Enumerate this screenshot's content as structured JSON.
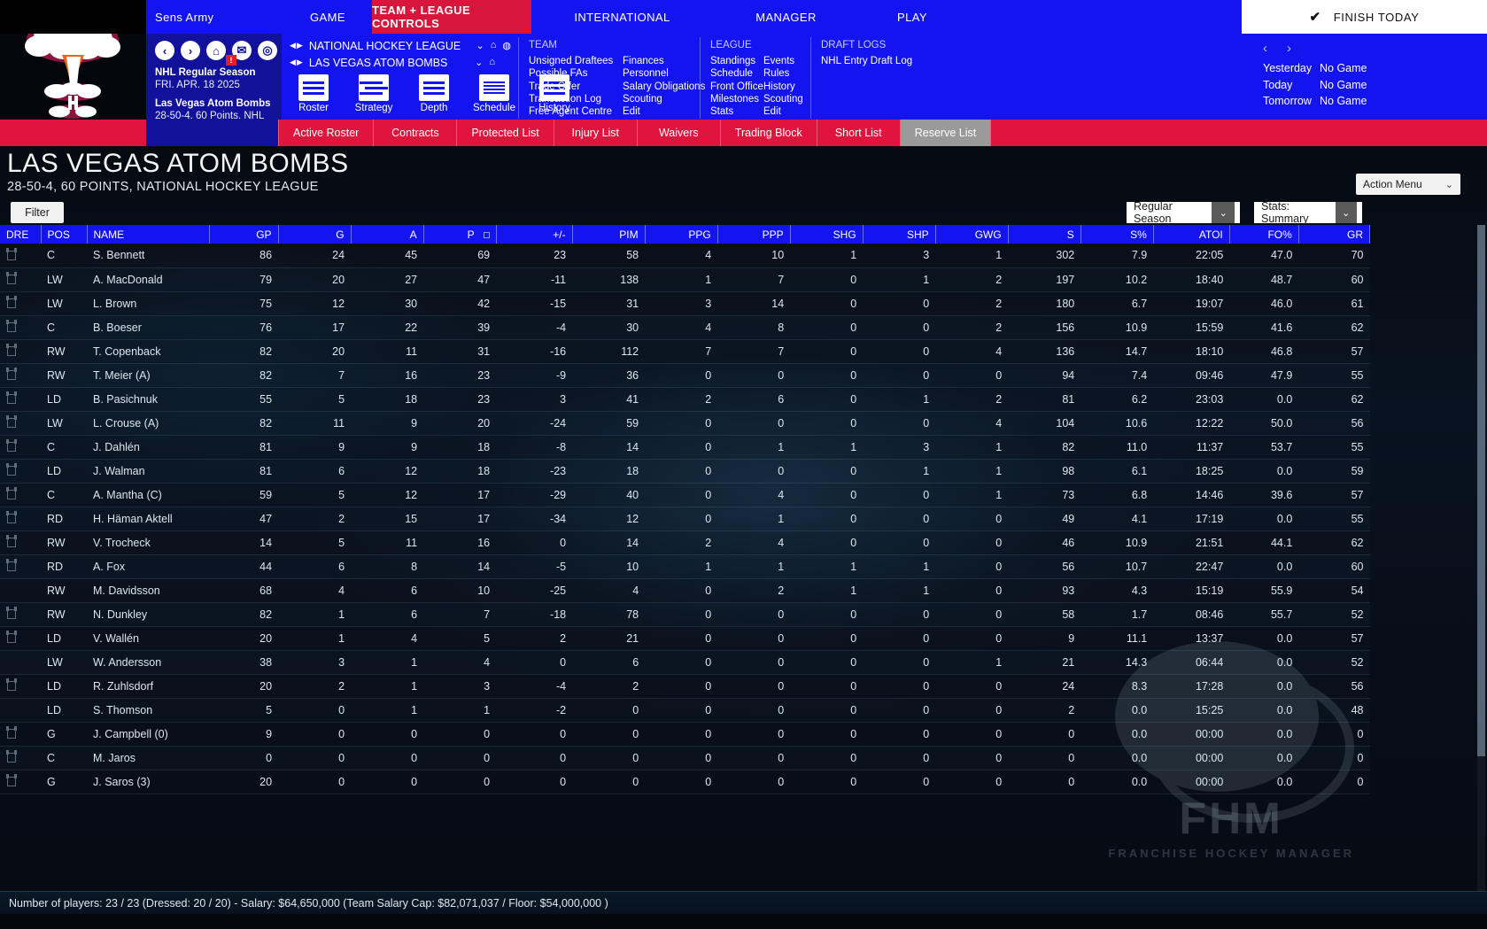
{
  "topmenu": {
    "user": "Sens Army",
    "items": [
      "GAME",
      "TEAM + LEAGUE CONTROLS",
      "INTERNATIONAL",
      "MANAGER",
      "PLAY"
    ],
    "finish_today": "FINISH TODAY",
    "check_icon": "check-icon"
  },
  "navbox": {
    "icons": [
      "back-icon",
      "forward-icon",
      "home-icon",
      "mail-icon",
      "search-icon"
    ],
    "mail_badge": "!",
    "season": "NHL Regular Season",
    "date": "FRI. APR. 18 2025",
    "team": "Las Vegas Atom Bombs",
    "record_line": "28-50-4, 60 Points, NHL"
  },
  "selector": {
    "league": "NATIONAL HOCKEY LEAGUE",
    "team": "LAS VEGAS ATOM BOMBS"
  },
  "quick_icons": [
    {
      "label": "Roster",
      "icon": "roster-icon"
    },
    {
      "label": "Strategy",
      "icon": "strategy-icon"
    },
    {
      "label": "Depth",
      "icon": "depth-icon"
    },
    {
      "label": "Schedule",
      "icon": "schedule-icon"
    },
    {
      "label": "History",
      "icon": "history-icon"
    }
  ],
  "menu_columns": [
    {
      "heading": "TEAM",
      "col_a": [
        "Unsigned Draftees",
        "Possible FAs",
        "Trade Offer",
        "Transaction Log",
        "Free Agent Centre"
      ],
      "col_b": [
        "Finances",
        "Personnel",
        "Salary Obligations",
        "Scouting",
        "Edit"
      ]
    },
    {
      "heading": "LEAGUE",
      "col_a": [
        "Standings",
        "Schedule",
        "Front Office",
        "Milestones",
        "Stats"
      ],
      "col_b": [
        "Events",
        "Rules",
        "History",
        "Scouting",
        "Edit"
      ]
    },
    {
      "heading": "DRAFT LOGS",
      "col_a": [
        "NHL Entry Draft Log"
      ],
      "col_b": []
    }
  ],
  "days": {
    "prev_icon": "chevron-left-icon",
    "next_icon": "chevron-right-icon",
    "rows": [
      {
        "label": "Yesterday",
        "value": "No Game"
      },
      {
        "label": "Today",
        "value": "No Game"
      },
      {
        "label": "Tomorrow",
        "value": "No Game"
      }
    ]
  },
  "tabs": [
    {
      "label": "Active Roster",
      "active": false
    },
    {
      "label": "Contracts",
      "active": false
    },
    {
      "label": "Protected List",
      "active": false
    },
    {
      "label": "Injury List",
      "active": false
    },
    {
      "label": "Waivers",
      "active": false
    },
    {
      "label": "Trading Block",
      "active": false
    },
    {
      "label": "Short List",
      "active": false
    },
    {
      "label": "Reserve List",
      "active": true
    }
  ],
  "page": {
    "title": "LAS VEGAS ATOM BOMBS",
    "subtitle": "28-50-4, 60 POINTS, NATIONAL HOCKEY LEAGUE",
    "action_menu": "Action Menu",
    "filter": "Filter",
    "season_select": "Regular Season",
    "stats_select": "Stats: Summary"
  },
  "colors": {
    "menu_blue": "#1414f0",
    "tab_red": "#e0143c",
    "active_tab_gray": "#9a9a9a",
    "accent_white": "#ffffff",
    "badge_red": "#e21d2e"
  },
  "table": {
    "columns": [
      "DRE",
      "POS",
      "NAME",
      "GP",
      "G",
      "A",
      "P",
      "+/-",
      "PIM",
      "PPG",
      "PPP",
      "SHG",
      "SHP",
      "GWG",
      "S",
      "S%",
      "ATOI",
      "FO%",
      "GR"
    ],
    "sorted_column": "P",
    "rows": [
      {
        "dre": true,
        "pos": "C",
        "name": "S. Bennett",
        "gp": "86",
        "g": "24",
        "a": "45",
        "p": "69",
        "pm": "23",
        "pim": "58",
        "ppg": "4",
        "ppp": "10",
        "shg": "1",
        "shp": "3",
        "gwg": "1",
        "s": "302",
        "sp": "7.9",
        "atoi": "22:05",
        "fo": "47.0",
        "gr": "70"
      },
      {
        "dre": true,
        "pos": "LW",
        "name": "A. MacDonald",
        "gp": "79",
        "g": "20",
        "a": "27",
        "p": "47",
        "pm": "-11",
        "pim": "138",
        "ppg": "1",
        "ppp": "7",
        "shg": "0",
        "shp": "1",
        "gwg": "2",
        "s": "197",
        "sp": "10.2",
        "atoi": "18:40",
        "fo": "48.7",
        "gr": "60"
      },
      {
        "dre": true,
        "pos": "LW",
        "name": "L. Brown",
        "gp": "75",
        "g": "12",
        "a": "30",
        "p": "42",
        "pm": "-15",
        "pim": "31",
        "ppg": "3",
        "ppp": "14",
        "shg": "0",
        "shp": "0",
        "gwg": "2",
        "s": "180",
        "sp": "6.7",
        "atoi": "19:07",
        "fo": "46.0",
        "gr": "61"
      },
      {
        "dre": true,
        "pos": "C",
        "name": "B. Boeser",
        "gp": "76",
        "g": "17",
        "a": "22",
        "p": "39",
        "pm": "-4",
        "pim": "30",
        "ppg": "4",
        "ppp": "8",
        "shg": "0",
        "shp": "0",
        "gwg": "2",
        "s": "156",
        "sp": "10.9",
        "atoi": "15:59",
        "fo": "41.6",
        "gr": "62"
      },
      {
        "dre": true,
        "pos": "RW",
        "name": "T. Copenback",
        "gp": "82",
        "g": "20",
        "a": "11",
        "p": "31",
        "pm": "-16",
        "pim": "112",
        "ppg": "7",
        "ppp": "7",
        "shg": "0",
        "shp": "0",
        "gwg": "4",
        "s": "136",
        "sp": "14.7",
        "atoi": "18:10",
        "fo": "46.8",
        "gr": "57"
      },
      {
        "dre": true,
        "pos": "RW",
        "name": "T. Meier (A)",
        "gp": "82",
        "g": "7",
        "a": "16",
        "p": "23",
        "pm": "-9",
        "pim": "36",
        "ppg": "0",
        "ppp": "0",
        "shg": "0",
        "shp": "0",
        "gwg": "0",
        "s": "94",
        "sp": "7.4",
        "atoi": "09:46",
        "fo": "47.9",
        "gr": "55"
      },
      {
        "dre": true,
        "pos": "LD",
        "name": "B. Pasichnuk",
        "gp": "55",
        "g": "5",
        "a": "18",
        "p": "23",
        "pm": "3",
        "pim": "41",
        "ppg": "2",
        "ppp": "6",
        "shg": "0",
        "shp": "1",
        "gwg": "2",
        "s": "81",
        "sp": "6.2",
        "atoi": "23:03",
        "fo": "0.0",
        "gr": "62"
      },
      {
        "dre": true,
        "pos": "LW",
        "name": "L. Crouse (A)",
        "gp": "82",
        "g": "11",
        "a": "9",
        "p": "20",
        "pm": "-24",
        "pim": "59",
        "ppg": "0",
        "ppp": "0",
        "shg": "0",
        "shp": "0",
        "gwg": "4",
        "s": "104",
        "sp": "10.6",
        "atoi": "12:22",
        "fo": "50.0",
        "gr": "56"
      },
      {
        "dre": true,
        "pos": "C",
        "name": "J. Dahlén",
        "gp": "81",
        "g": "9",
        "a": "9",
        "p": "18",
        "pm": "-8",
        "pim": "14",
        "ppg": "0",
        "ppp": "1",
        "shg": "1",
        "shp": "3",
        "gwg": "1",
        "s": "82",
        "sp": "11.0",
        "atoi": "11:37",
        "fo": "53.7",
        "gr": "55"
      },
      {
        "dre": true,
        "pos": "LD",
        "name": "J. Walman",
        "gp": "81",
        "g": "6",
        "a": "12",
        "p": "18",
        "pm": "-23",
        "pim": "18",
        "ppg": "0",
        "ppp": "0",
        "shg": "0",
        "shp": "1",
        "gwg": "1",
        "s": "98",
        "sp": "6.1",
        "atoi": "18:25",
        "fo": "0.0",
        "gr": "59"
      },
      {
        "dre": true,
        "pos": "C",
        "name": "A. Mantha (C)",
        "gp": "59",
        "g": "5",
        "a": "12",
        "p": "17",
        "pm": "-29",
        "pim": "40",
        "ppg": "0",
        "ppp": "4",
        "shg": "0",
        "shp": "0",
        "gwg": "1",
        "s": "73",
        "sp": "6.8",
        "atoi": "14:46",
        "fo": "39.6",
        "gr": "57"
      },
      {
        "dre": true,
        "pos": "RD",
        "name": "H. Häman Aktell",
        "gp": "47",
        "g": "2",
        "a": "15",
        "p": "17",
        "pm": "-34",
        "pim": "12",
        "ppg": "0",
        "ppp": "1",
        "shg": "0",
        "shp": "0",
        "gwg": "0",
        "s": "49",
        "sp": "4.1",
        "atoi": "17:19",
        "fo": "0.0",
        "gr": "55"
      },
      {
        "dre": true,
        "pos": "RW",
        "name": "V. Trocheck",
        "gp": "14",
        "g": "5",
        "a": "11",
        "p": "16",
        "pm": "0",
        "pim": "14",
        "ppg": "2",
        "ppp": "4",
        "shg": "0",
        "shp": "0",
        "gwg": "0",
        "s": "46",
        "sp": "10.9",
        "atoi": "21:51",
        "fo": "44.1",
        "gr": "62"
      },
      {
        "dre": true,
        "pos": "RD",
        "name": "A. Fox",
        "gp": "44",
        "g": "6",
        "a": "8",
        "p": "14",
        "pm": "-5",
        "pim": "10",
        "ppg": "1",
        "ppp": "1",
        "shg": "1",
        "shp": "1",
        "gwg": "0",
        "s": "56",
        "sp": "10.7",
        "atoi": "22:47",
        "fo": "0.0",
        "gr": "60"
      },
      {
        "dre": false,
        "pos": "RW",
        "name": "M. Davidsson",
        "gp": "68",
        "g": "4",
        "a": "6",
        "p": "10",
        "pm": "-25",
        "pim": "4",
        "ppg": "0",
        "ppp": "2",
        "shg": "1",
        "shp": "1",
        "gwg": "0",
        "s": "93",
        "sp": "4.3",
        "atoi": "15:19",
        "fo": "55.9",
        "gr": "54"
      },
      {
        "dre": true,
        "pos": "RW",
        "name": "N. Dunkley",
        "gp": "82",
        "g": "1",
        "a": "6",
        "p": "7",
        "pm": "-18",
        "pim": "78",
        "ppg": "0",
        "ppp": "0",
        "shg": "0",
        "shp": "0",
        "gwg": "0",
        "s": "58",
        "sp": "1.7",
        "atoi": "08:46",
        "fo": "55.7",
        "gr": "52"
      },
      {
        "dre": true,
        "pos": "LD",
        "name": "V. Wallén",
        "gp": "20",
        "g": "1",
        "a": "4",
        "p": "5",
        "pm": "2",
        "pim": "21",
        "ppg": "0",
        "ppp": "0",
        "shg": "0",
        "shp": "0",
        "gwg": "0",
        "s": "9",
        "sp": "11.1",
        "atoi": "13:37",
        "fo": "0.0",
        "gr": "57"
      },
      {
        "dre": false,
        "pos": "LW",
        "name": "W. Andersson",
        "gp": "38",
        "g": "3",
        "a": "1",
        "p": "4",
        "pm": "0",
        "pim": "6",
        "ppg": "0",
        "ppp": "0",
        "shg": "0",
        "shp": "0",
        "gwg": "1",
        "s": "21",
        "sp": "14.3",
        "atoi": "06:44",
        "fo": "0.0",
        "gr": "52"
      },
      {
        "dre": true,
        "pos": "LD",
        "name": "R. Zuhlsdorf",
        "gp": "20",
        "g": "2",
        "a": "1",
        "p": "3",
        "pm": "-4",
        "pim": "2",
        "ppg": "0",
        "ppp": "0",
        "shg": "0",
        "shp": "0",
        "gwg": "0",
        "s": "24",
        "sp": "8.3",
        "atoi": "17:28",
        "fo": "0.0",
        "gr": "56"
      },
      {
        "dre": false,
        "pos": "LD",
        "name": "S. Thomson",
        "gp": "5",
        "g": "0",
        "a": "1",
        "p": "1",
        "pm": "-2",
        "pim": "0",
        "ppg": "0",
        "ppp": "0",
        "shg": "0",
        "shp": "0",
        "gwg": "0",
        "s": "2",
        "sp": "0.0",
        "atoi": "15:25",
        "fo": "0.0",
        "gr": "48"
      },
      {
        "dre": true,
        "pos": "G",
        "name": "J. Campbell (0)",
        "gp": "9",
        "g": "0",
        "a": "0",
        "p": "0",
        "pm": "0",
        "pim": "0",
        "ppg": "0",
        "ppp": "0",
        "shg": "0",
        "shp": "0",
        "gwg": "0",
        "s": "0",
        "sp": "0.0",
        "atoi": "00:00",
        "fo": "0.0",
        "gr": "0"
      },
      {
        "dre": true,
        "pos": "C",
        "name": "M. Jaros",
        "gp": "0",
        "g": "0",
        "a": "0",
        "p": "0",
        "pm": "0",
        "pim": "0",
        "ppg": "0",
        "ppp": "0",
        "shg": "0",
        "shp": "0",
        "gwg": "0",
        "s": "0",
        "sp": "0.0",
        "atoi": "00:00",
        "fo": "0.0",
        "gr": "0"
      },
      {
        "dre": true,
        "pos": "G",
        "name": "J. Saros (3)",
        "gp": "20",
        "g": "0",
        "a": "0",
        "p": "0",
        "pm": "0",
        "pim": "0",
        "ppg": "0",
        "ppp": "0",
        "shg": "0",
        "shp": "0",
        "gwg": "0",
        "s": "0",
        "sp": "0.0",
        "atoi": "00:00",
        "fo": "0.0",
        "gr": "0"
      }
    ]
  },
  "footer": {
    "text": "Number of players: 23 / 23 (Dressed: 20 / 20)  -   Salary: $64,650,000  (Team Salary Cap: $82,071,037 / Floor: $54,000,000 )"
  }
}
